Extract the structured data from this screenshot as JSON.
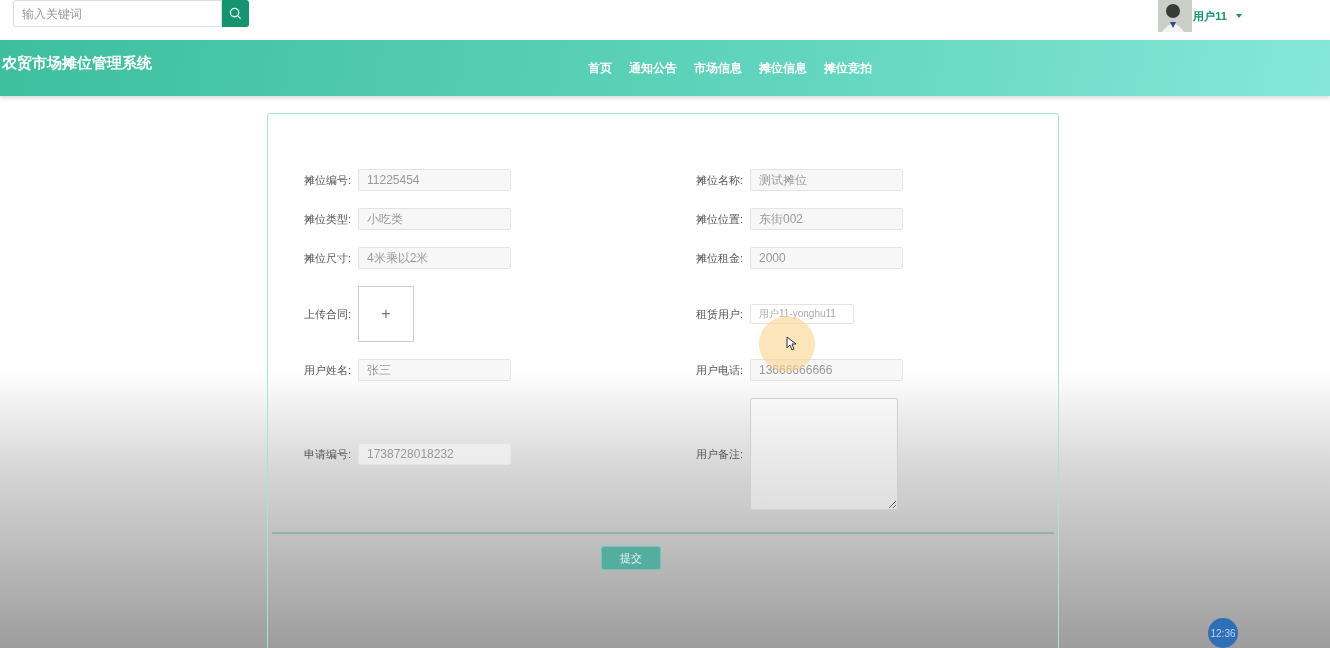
{
  "search": {
    "placeholder": "输入关键词"
  },
  "user": {
    "name": "用户11"
  },
  "header": {
    "title": "农贸市场摊位管理系统"
  },
  "nav": [
    {
      "label": "首页"
    },
    {
      "label": "通知公告"
    },
    {
      "label": "市场信息"
    },
    {
      "label": "摊位信息"
    },
    {
      "label": "摊位竞拍"
    }
  ],
  "form": {
    "rows": [
      [
        {
          "label": "摊位编号:",
          "kind": "input",
          "value": "11225454"
        },
        {
          "label": "摊位名称:",
          "kind": "input",
          "value": "测试摊位"
        }
      ],
      [
        {
          "label": "摊位类型:",
          "kind": "input",
          "value": "小吃类"
        },
        {
          "label": "摊位位置:",
          "kind": "input",
          "value": "东街002"
        }
      ],
      [
        {
          "label": "摊位尺寸:",
          "kind": "input",
          "value": "4米乘以2米"
        },
        {
          "label": "摊位租金:",
          "kind": "input",
          "value": "2000"
        }
      ],
      [
        {
          "label": "上传合同:",
          "kind": "upload",
          "icon": "+"
        },
        {
          "label": "租赁用户:",
          "kind": "select",
          "value": "用户11-yonghu11"
        }
      ],
      [
        {
          "label": "用户姓名:",
          "kind": "input",
          "value": "张三"
        },
        {
          "label": "用户电话:",
          "kind": "input",
          "value": "13666666666"
        }
      ],
      [
        {
          "label": "申请编号:",
          "kind": "input",
          "value": "1738728018232"
        },
        {
          "label": "用户备注:",
          "kind": "textarea"
        }
      ]
    ],
    "submit": "提交"
  },
  "clock": "12:36"
}
